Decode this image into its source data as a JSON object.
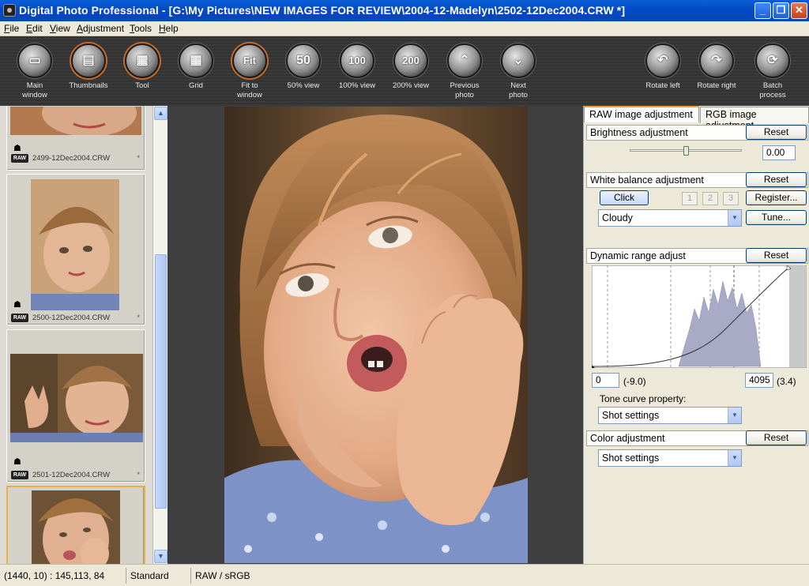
{
  "window": {
    "title": "Digital Photo Professional - [G:\\My Pictures\\NEW IMAGES FOR REVIEW\\2004-12-Madelyn\\2502-12Dec2004.CRW *]",
    "minimize": "_",
    "maximize": "❐",
    "close": "✕"
  },
  "menu": [
    "File",
    "Edit",
    "View",
    "Adjustment",
    "Tools",
    "Help"
  ],
  "toolbar": {
    "left": [
      {
        "label1": "Main",
        "label2": "window",
        "icon": "main-window-icon",
        "glyph": "▭"
      },
      {
        "label1": "Thumbnails",
        "label2": "",
        "icon": "thumbnails-icon",
        "glyph": "▤",
        "active": true
      },
      {
        "label1": "Tool",
        "label2": "",
        "icon": "tool-palette-icon",
        "glyph": "▦",
        "active": true
      },
      {
        "label1": "Grid",
        "label2": "",
        "icon": "grid-icon",
        "glyph": "▦"
      },
      {
        "label1": "Fit to",
        "label2": "window",
        "icon": "fit-to-window-icon",
        "glyph": "Fit",
        "active": true
      },
      {
        "label1": "50% view",
        "label2": "",
        "icon": "zoom-50-icon",
        "glyph": "50"
      },
      {
        "label1": "100% view",
        "label2": "",
        "icon": "zoom-100-icon",
        "glyph": "100"
      },
      {
        "label1": "200% view",
        "label2": "",
        "icon": "zoom-200-icon",
        "glyph": "200"
      },
      {
        "label1": "Previous",
        "label2": "photo",
        "icon": "previous-photo-icon",
        "glyph": "⌃"
      },
      {
        "label1": "Next",
        "label2": "photo",
        "icon": "next-photo-icon",
        "glyph": "⌄"
      }
    ],
    "right": [
      {
        "label1": "Rotate left",
        "label2": "",
        "icon": "rotate-left-icon",
        "glyph": "↶"
      },
      {
        "label1": "Rotate right",
        "label2": "",
        "icon": "rotate-right-icon",
        "glyph": "↷"
      },
      {
        "label1": "Batch",
        "label2": "process",
        "icon": "batch-process-icon",
        "glyph": "⟳"
      }
    ]
  },
  "thumbnails": [
    {
      "file": "2499-12Dec2004.CRW",
      "star": "*",
      "badge": "RAW"
    },
    {
      "file": "2500-12Dec2004.CRW",
      "star": "*",
      "badge": "RAW"
    },
    {
      "file": "2501-12Dec2004.CRW",
      "star": "*",
      "badge": "RAW"
    }
  ],
  "panel": {
    "tab_raw": "RAW image adjustment",
    "tab_rgb": "RGB image adjustment",
    "brightness": {
      "title": "Brightness adjustment",
      "reset": "Reset",
      "value": "0.00"
    },
    "white_balance": {
      "title": "White balance adjustment",
      "reset": "Reset",
      "click": "Click",
      "presets": [
        "1",
        "2",
        "3"
      ],
      "register": "Register...",
      "mode": "Cloudy",
      "tune": "Tune..."
    },
    "dynamic_range": {
      "title": "Dynamic range adjust",
      "reset": "Reset",
      "low_value": "0",
      "low_ev": "(-9.0)",
      "high_value": "4095",
      "high_ev": "(3.4)",
      "tone_curve_label": "Tone curve property:",
      "tone_curve_value": "Shot settings"
    },
    "color": {
      "title": "Color adjustment",
      "reset": "Reset",
      "value": "Shot settings"
    }
  },
  "status": {
    "coords": "(1440,  10) : 145,113, 84",
    "mode": "Standard",
    "space": "RAW / sRGB"
  },
  "colors": {
    "titlebar": "#0349c6",
    "toolbar": "#363636",
    "histogram_fill": "#a9abc6",
    "accent": "#e8b04a"
  }
}
